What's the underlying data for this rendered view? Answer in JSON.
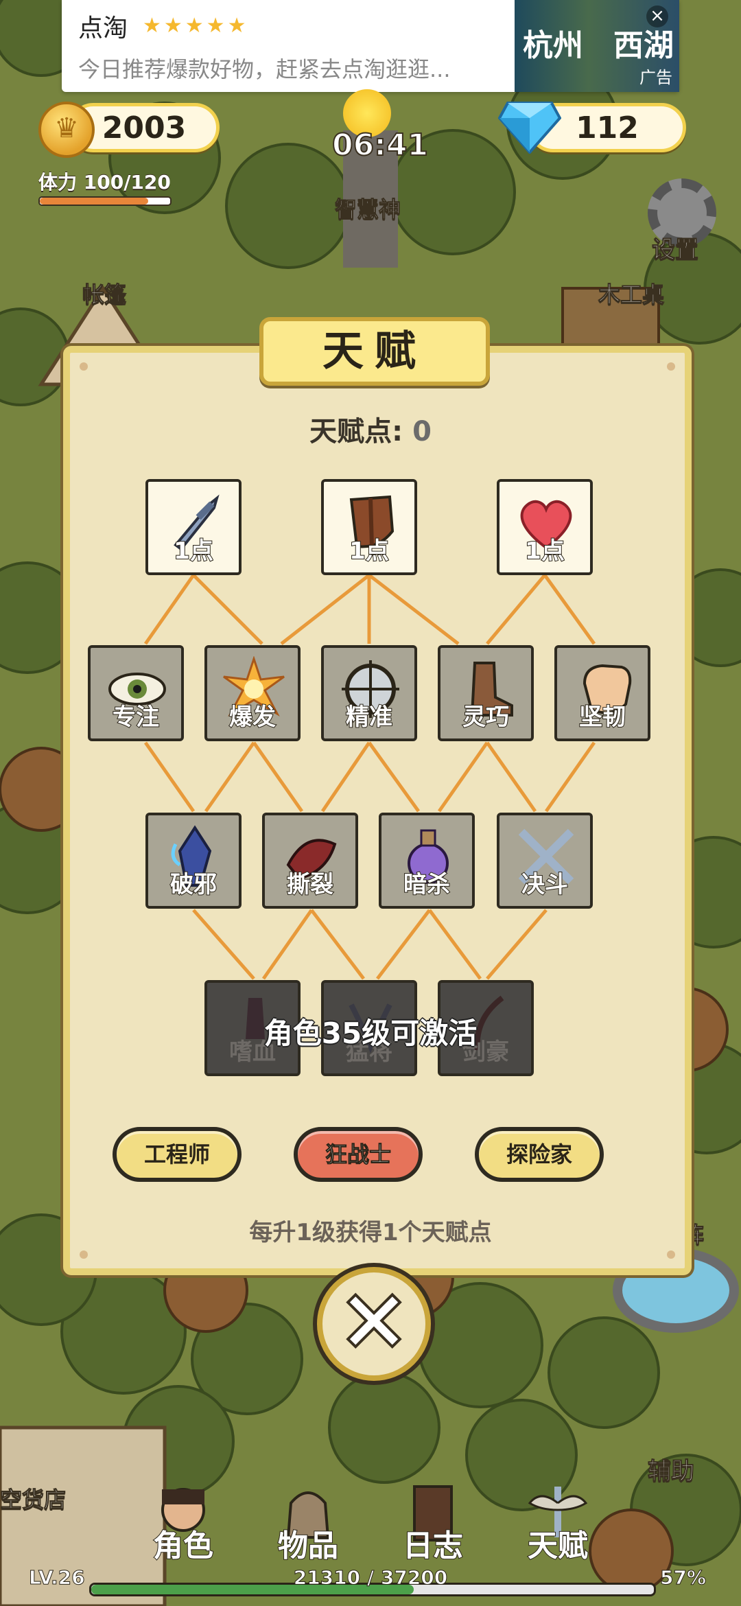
{
  "ad": {
    "brand": "点淘",
    "stars": "★★★★★",
    "text": "今日推荐爆款好物，赶紧去点淘逛逛...",
    "image_text_left": "杭州",
    "image_text_right": "西湖",
    "close": "×",
    "tag": "广告"
  },
  "hud": {
    "coins": "2003",
    "gems": "112",
    "time": "06:41",
    "stamina": "体力 100/120",
    "stamina_ratio": 0.833,
    "settings_label": "设置"
  },
  "map_labels": {
    "statue": "智慧神",
    "tent": "帐篷",
    "workbench": "木工桌",
    "formation": "阵",
    "shop": "空货店",
    "assist": "辅助"
  },
  "panel": {
    "title": "天赋",
    "points_label": "天赋点:",
    "points_value": "0",
    "tier1": [
      {
        "label": "1点",
        "art": "sword"
      },
      {
        "label": "1点",
        "art": "shield"
      },
      {
        "label": "1点",
        "art": "heart"
      }
    ],
    "tier2": [
      {
        "label": "专注",
        "art": "eye"
      },
      {
        "label": "爆发",
        "art": "burst"
      },
      {
        "label": "精准",
        "art": "crosshair"
      },
      {
        "label": "灵巧",
        "art": "boot"
      },
      {
        "label": "坚韧",
        "art": "fist"
      }
    ],
    "tier3": [
      {
        "label": "破邪",
        "art": "crystal"
      },
      {
        "label": "撕裂",
        "art": "claw"
      },
      {
        "label": "暗杀",
        "art": "potion"
      },
      {
        "label": "决斗",
        "art": "swords"
      }
    ],
    "tier4": [
      {
        "label": "嗜血",
        "art": "blood"
      },
      {
        "label": "猛将",
        "art": "horns"
      },
      {
        "label": "剑豪",
        "art": "blade"
      }
    ],
    "lock_message": "角色35级可激活",
    "classes": [
      "工程师",
      "狂战士",
      "探险家"
    ],
    "selected_class": "狂战士",
    "footer": "每升1级获得1个天赋点",
    "close_symbol": "✕"
  },
  "nav": {
    "items": [
      "角色",
      "物品",
      "日志",
      "天赋"
    ]
  },
  "xp": {
    "level": "LV.26",
    "text": "21310 / 37200",
    "percent_text": "57%",
    "ratio": 0.573
  },
  "colors": {
    "accent": "#f2d14d",
    "selected_class": "#e6735a",
    "line": "#e89a3a",
    "xp": "#4ca04a"
  }
}
